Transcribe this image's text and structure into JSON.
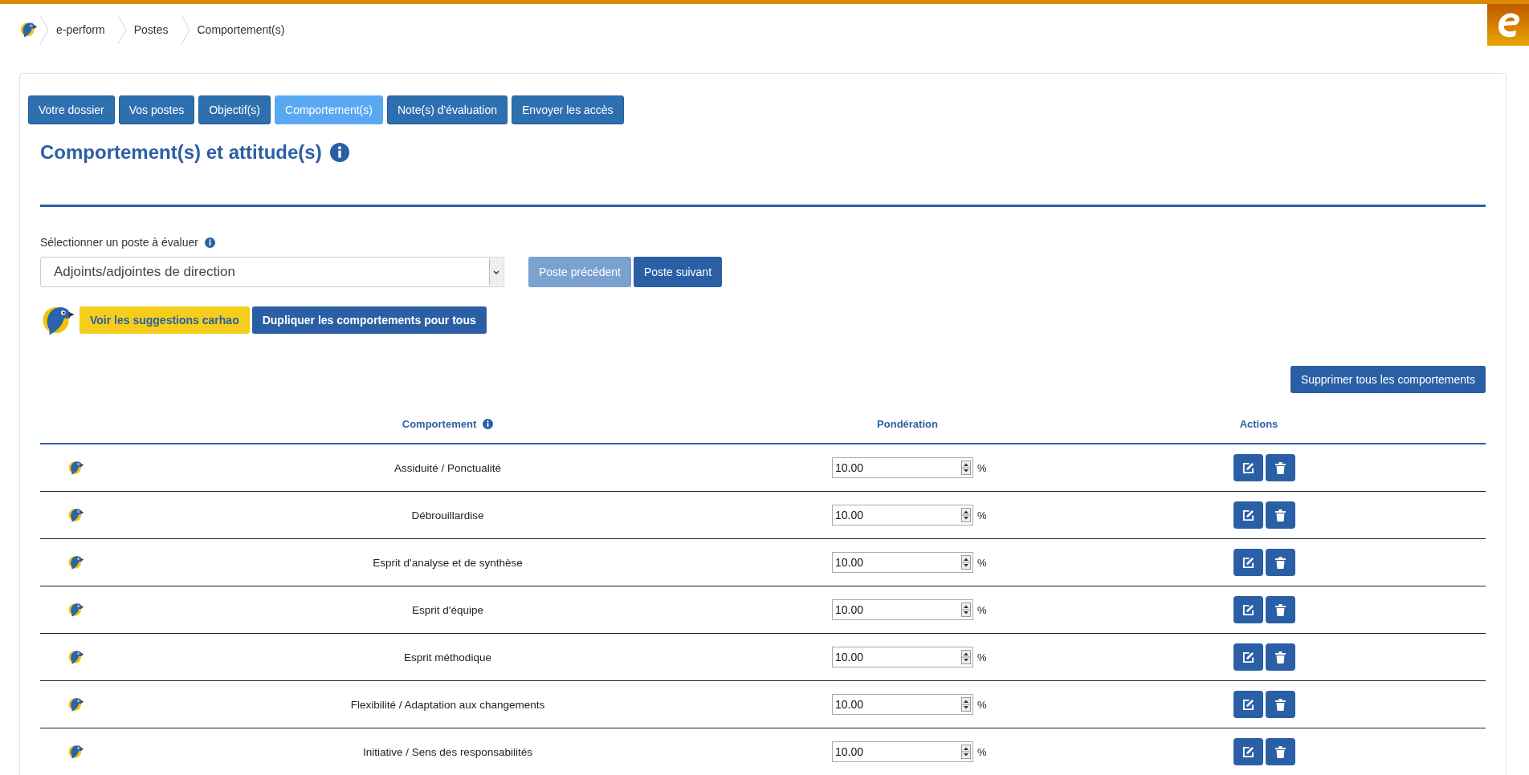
{
  "breadcrumb": [
    "e-perform",
    "Postes",
    "Comportement(s)"
  ],
  "tabs": [
    {
      "label": "Votre dossier",
      "selected": false
    },
    {
      "label": "Vos postes",
      "selected": false
    },
    {
      "label": "Objectif(s)",
      "selected": false
    },
    {
      "label": "Comportement(s)",
      "selected": true
    },
    {
      "label": "Note(s) d'évaluation",
      "selected": false
    },
    {
      "label": "Envoyer les accès",
      "selected": false
    }
  ],
  "title": "Comportement(s) et attitude(s)",
  "poste_select": {
    "label": "Sélectionner un poste à évaluer",
    "value": "Adjoints/adjointes de direction"
  },
  "nav_buttons": [
    {
      "label": "Poste précédent",
      "disabled": true
    },
    {
      "label": "Poste suivant",
      "disabled": false
    }
  ],
  "suggestion_buttons": [
    {
      "label": "Voir les suggestions carhao",
      "kind": "suggest"
    },
    {
      "label": "Dupliquer les comportements pour tous",
      "kind": "primary"
    }
  ],
  "delete_all_button": "Supprimer tous les comportements",
  "table": {
    "columns": [
      "Comportement",
      "Pondération",
      "Actions"
    ],
    "rows": [
      {
        "name": "Assiduité / Ponctualité",
        "weight": "10.00",
        "unit": "%"
      },
      {
        "name": "Débrouillardise",
        "weight": "10.00",
        "unit": "%"
      },
      {
        "name": "Esprit d'analyse et de synthèse",
        "weight": "10.00",
        "unit": "%"
      },
      {
        "name": "Esprit d'équipe",
        "weight": "10.00",
        "unit": "%"
      },
      {
        "name": "Esprit méthodique",
        "weight": "10.00",
        "unit": "%"
      },
      {
        "name": "Flexibilité / Adaptation aux changements",
        "weight": "10.00",
        "unit": "%"
      },
      {
        "name": "Initiative / Sens des responsabilités",
        "weight": "10.00",
        "unit": "%"
      }
    ]
  }
}
